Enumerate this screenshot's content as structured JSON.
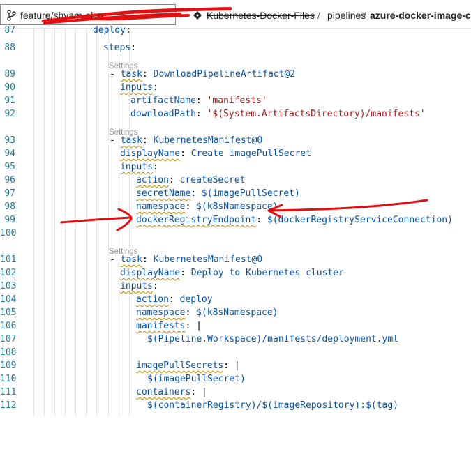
{
  "header": {
    "branch_name": "feature/shyam-aks-...",
    "repo_name": "Kubernetes-Docker-Files",
    "path_separator": "/",
    "path_folder": "pipelines",
    "path_slash": "/",
    "path_file": "azure-docker-image-cre",
    "colors": {
      "text": "#201f1e",
      "border": "#8a8a8a"
    },
    "icons": {
      "branch": "git-branch-icon",
      "repo": "repository-icon"
    }
  },
  "editor": {
    "codelens_label": "Settings",
    "colors": {
      "key": "#0451a5",
      "value": "#a31515",
      "line_number": "#237893",
      "squiggle": "#bf8803",
      "codelens": "#919191"
    },
    "lines": [
      {
        "n": "87",
        "key": "deploy",
        "colon": ":",
        "value": ""
      },
      {
        "n": "88",
        "key": "steps",
        "colon": ":",
        "value": ""
      },
      {
        "n": "89",
        "dash": "- ",
        "key": "task",
        "colon": ":",
        "value": " DownloadPipelineArtifact@2"
      },
      {
        "n": "90",
        "key": "inputs",
        "colon": ":",
        "value": ""
      },
      {
        "n": "91",
        "key": "artifactName",
        "colon": ":",
        "value": " 'manifests'"
      },
      {
        "n": "92",
        "key": "downloadPath",
        "colon": ":",
        "value": " '$(System.ArtifactsDirectory)/manifests'"
      },
      {
        "n": "93",
        "dash": "- ",
        "key": "task",
        "colon": ":",
        "value": " KubernetesManifest@0"
      },
      {
        "n": "94",
        "key": "displayName",
        "colon": ":",
        "value": " Create imagePullSecret"
      },
      {
        "n": "95",
        "key": "inputs",
        "colon": ":",
        "value": ""
      },
      {
        "n": "96",
        "key": "action",
        "colon": ":",
        "value": " createSecret"
      },
      {
        "n": "97",
        "key": "secretName",
        "colon": ":",
        "value": " $(imagePullSecret)"
      },
      {
        "n": "98",
        "key": "namespace",
        "colon": ":",
        "value": " $(k8sNamespace)"
      },
      {
        "n": "99",
        "key": "dockerRegistryEndpoint",
        "colon": ":",
        "value": " $(dockerRegistryServiceConnection)"
      },
      {
        "n": "100",
        "key": "",
        "colon": "",
        "value": ""
      },
      {
        "n": "101",
        "dash": "- ",
        "key": "task",
        "colon": ":",
        "value": " KubernetesManifest@0"
      },
      {
        "n": "102",
        "key": "displayName",
        "colon": ":",
        "value": " Deploy to Kubernetes cluster"
      },
      {
        "n": "103",
        "key": "inputs",
        "colon": ":",
        "value": ""
      },
      {
        "n": "104",
        "key": "action",
        "colon": ":",
        "value": " deploy"
      },
      {
        "n": "105",
        "key": "namespace",
        "colon": ":",
        "value": " $(k8sNamespace)"
      },
      {
        "n": "106",
        "key": "manifests",
        "colon": ":",
        "value": " |"
      },
      {
        "n": "107",
        "key": "",
        "colon": "",
        "value": "$(Pipeline.Workspace)/manifests/deployment.yml"
      },
      {
        "n": "108",
        "key": "",
        "colon": "",
        "value": ""
      },
      {
        "n": "109",
        "key": "imagePullSecrets",
        "colon": ":",
        "value": " |"
      },
      {
        "n": "110",
        "key": "",
        "colon": "",
        "value": "$(imagePullSecret)"
      },
      {
        "n": "111",
        "key": "containers",
        "colon": ":",
        "value": " |"
      },
      {
        "n": "112",
        "key": "",
        "colon": "",
        "value": "$(containerRegistry)/$(imageRepository):$(tag)"
      }
    ]
  }
}
